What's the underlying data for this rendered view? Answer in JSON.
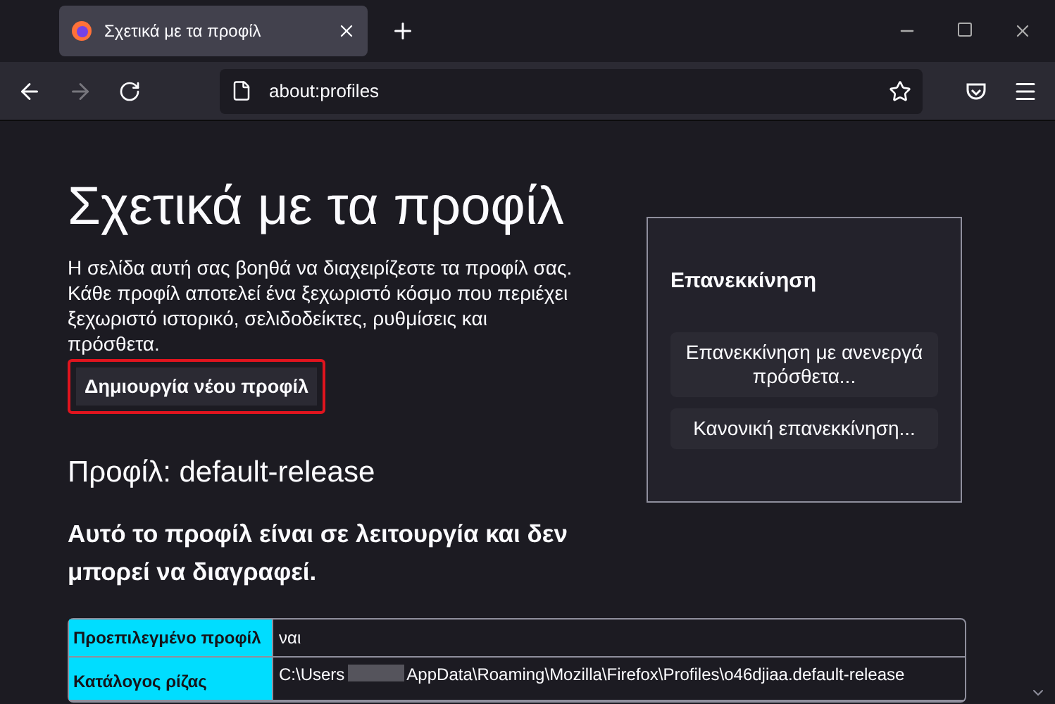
{
  "tab": {
    "title": "Σχετικά με τα προφίλ"
  },
  "address_bar": {
    "url": "about:profiles"
  },
  "page": {
    "title": "Σχετικά με τα προφίλ",
    "intro": "Η σελίδα αυτή σας βοηθά να διαχειρίζεστε τα προφίλ σας. Κάθε προφίλ αποτελεί ένα ξεχωριστό κόσμο που περιέχει ξεχωριστό ιστορικό, σελιδοδείκτες, ρυθμίσεις και πρόσθετα.",
    "create_button": {
      "label": "Δημιουργία νέου προφίλ",
      "highlighted": true
    },
    "profile_heading": "Προφίλ: default-release",
    "profile_status": "Αυτό το προφίλ είναι σε λειτουργία και δεν μπορεί να διαγραφεί.",
    "table": {
      "rows": [
        {
          "label": "Προεπιλεγμένο προφίλ",
          "value": "ναι"
        },
        {
          "label": "Κατάλογος ρίζας",
          "value_start": "C:\\Users",
          "value_end": "AppData\\Roaming\\Mozilla\\Firefox\\Profiles\\o46djiaa.default-release",
          "redacted": true
        }
      ]
    }
  },
  "restart_panel": {
    "title": "Επανεκκίνηση",
    "buttons": [
      "Επανεκκίνηση με ανενεργά πρόσθετα...",
      "Κανονική επανεκκίνηση..."
    ]
  }
}
